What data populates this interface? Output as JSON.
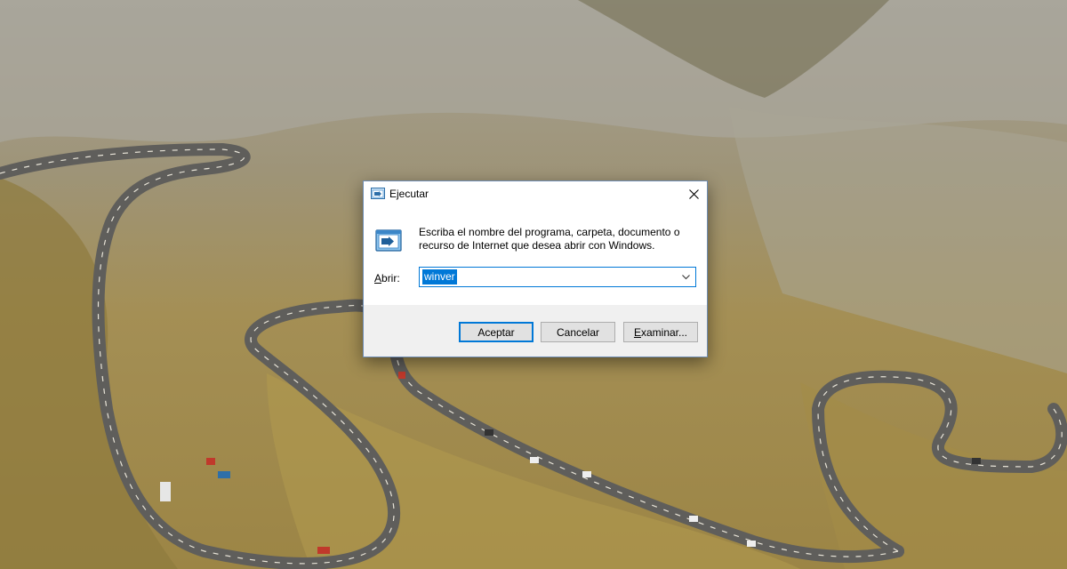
{
  "dialog": {
    "title": "Ejecutar",
    "description": "Escriba el nombre del programa, carpeta, documento o recurso de Internet que desea abrir con Windows.",
    "open_label_mnemonic": "A",
    "open_label_rest": "brir:",
    "input_value": "winver",
    "buttons": {
      "ok": "Aceptar",
      "cancel": "Cancelar",
      "browse_mnemonic": "E",
      "browse_rest": "xaminar..."
    }
  },
  "icons": {
    "title": "run-icon",
    "prompt": "run-icon",
    "close": "close-icon",
    "dropdown": "chevron-down-icon"
  },
  "colors": {
    "accent": "#0078d7",
    "footer": "#f0f0f0",
    "button_face": "#e1e1e1"
  }
}
